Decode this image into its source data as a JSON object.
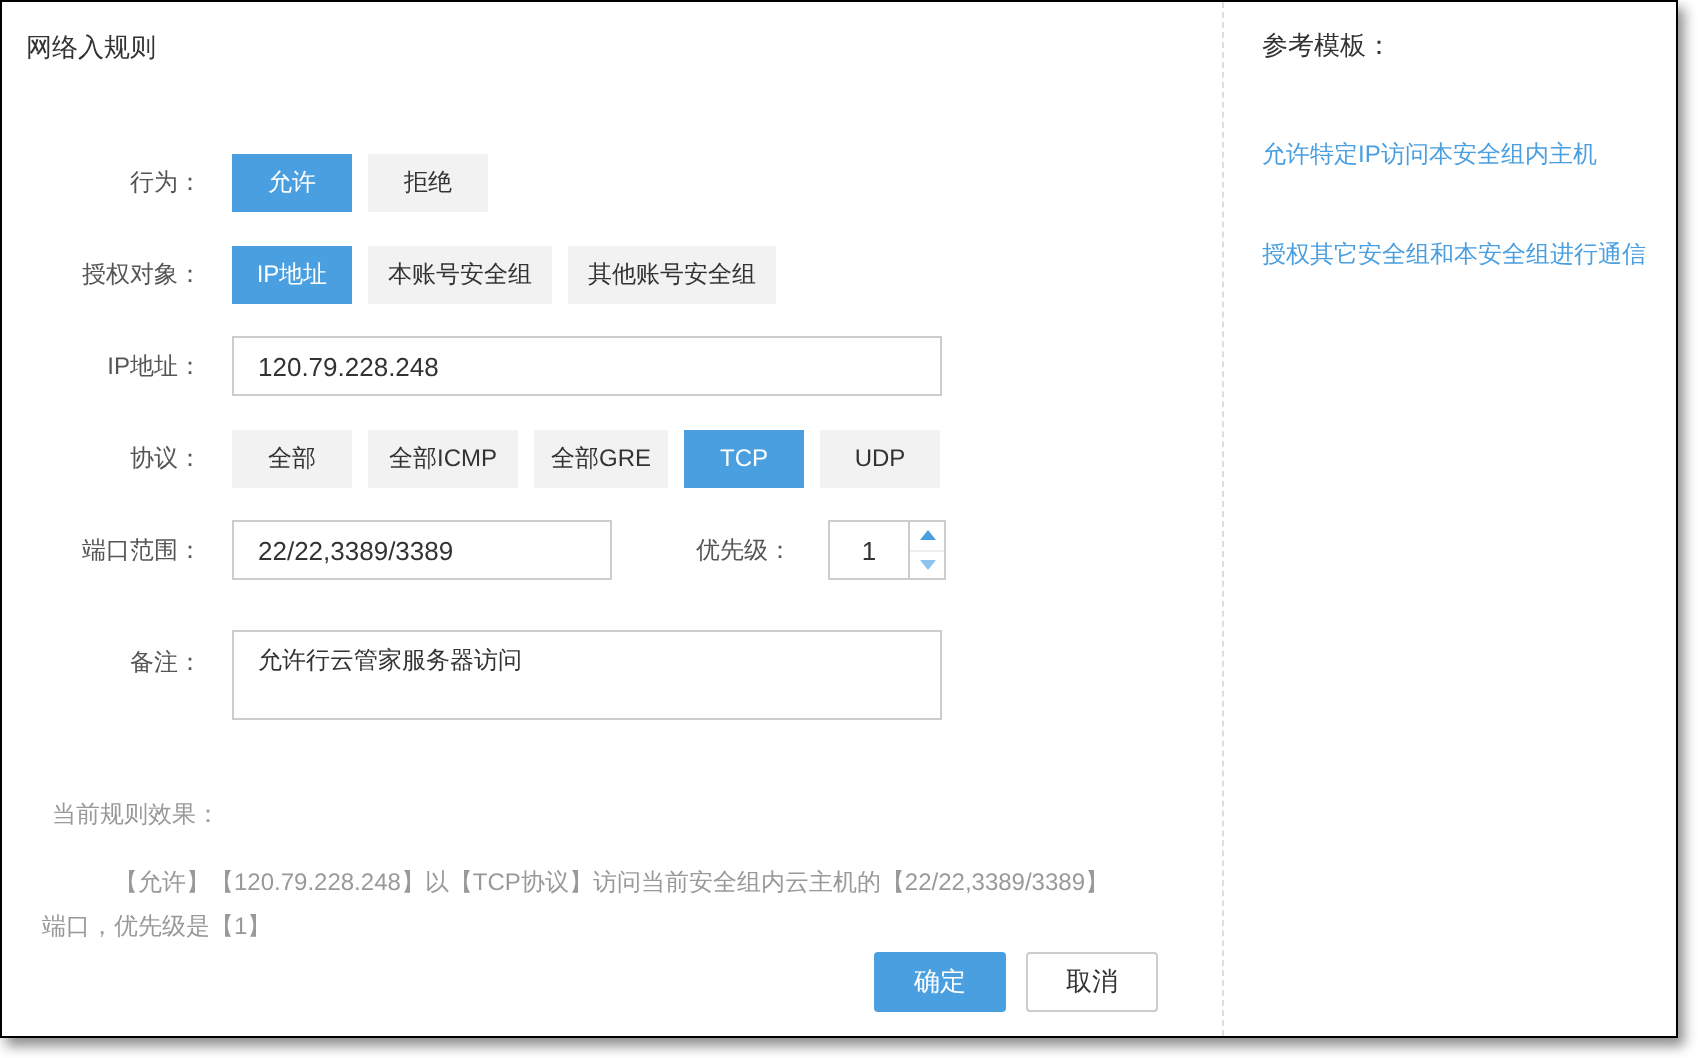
{
  "dialog": {
    "title": "网络入规则"
  },
  "action": {
    "label": "行为：",
    "options": [
      {
        "label": "允许",
        "selected": true
      },
      {
        "label": "拒绝",
        "selected": false
      }
    ]
  },
  "auth_target": {
    "label": "授权对象：",
    "options": [
      {
        "label": "IP地址",
        "selected": true
      },
      {
        "label": "本账号安全组",
        "selected": false
      },
      {
        "label": "其他账号安全组",
        "selected": false
      }
    ]
  },
  "ip": {
    "label": "IP地址：",
    "value": "120.79.228.248"
  },
  "protocol": {
    "label": "协议：",
    "options": [
      {
        "label": "全部",
        "selected": false
      },
      {
        "label": "全部ICMP",
        "selected": false
      },
      {
        "label": "全部GRE",
        "selected": false
      },
      {
        "label": "TCP",
        "selected": true
      },
      {
        "label": "UDP",
        "selected": false
      }
    ]
  },
  "port": {
    "label": "端口范围：",
    "value": "22/22,3389/3389"
  },
  "priority": {
    "label": "优先级：",
    "value": "1"
  },
  "remark": {
    "label": "备注：",
    "value": "允许行云管家服务器访问"
  },
  "summary": {
    "heading": "当前规则效果：",
    "text": "【允许】【120.79.228.248】以【TCP协议】访问当前安全组内云主机的【22/22,3389/3389】端口，优先级是【1】"
  },
  "buttons": [
    {
      "label": "确定",
      "kind": "primary"
    },
    {
      "label": "取消",
      "kind": "secondary"
    }
  ],
  "templates": {
    "title": "参考模板：",
    "links": [
      "允许特定IP访问本安全组内主机",
      "授权其它安全组和本安全组进行通信"
    ]
  }
}
